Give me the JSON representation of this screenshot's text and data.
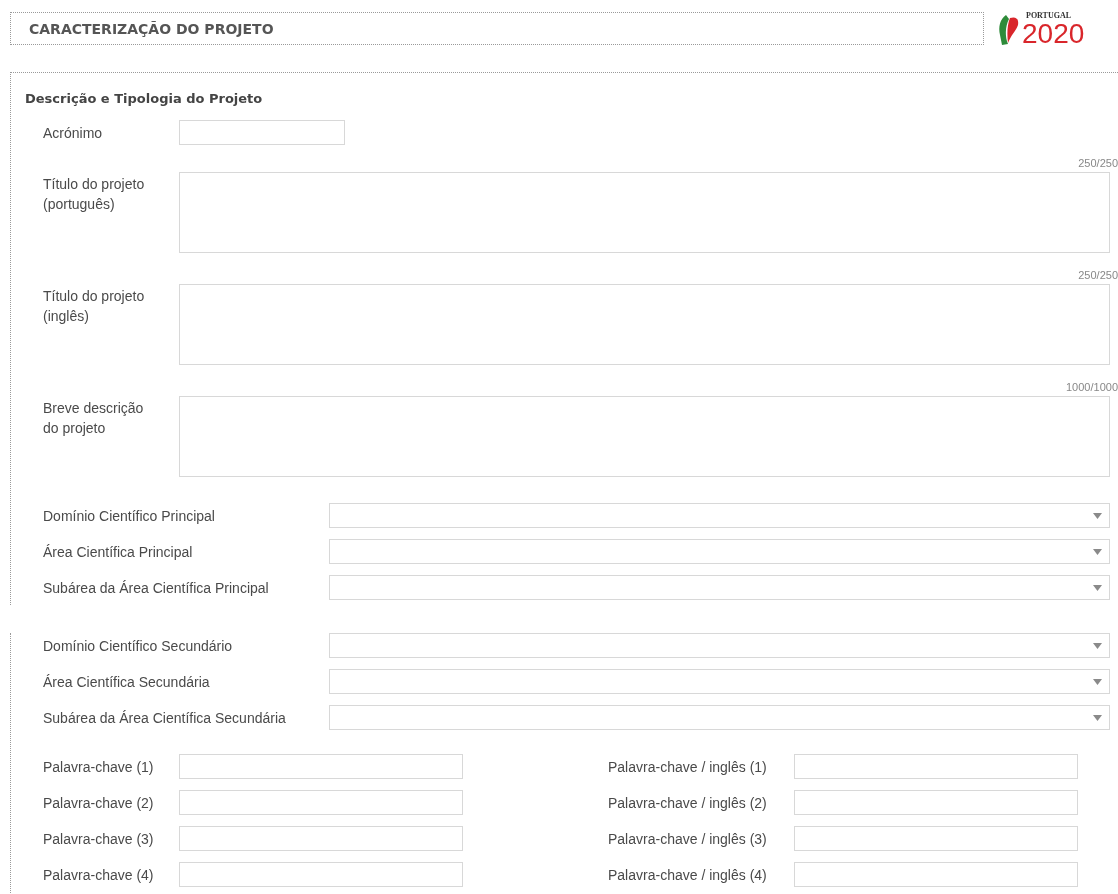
{
  "header": {
    "title": "CARACTERIZAÇÃO DO PROJETO"
  },
  "logo": {
    "caption": "PORTUGAL",
    "year": "2020"
  },
  "section": {
    "title": "Descrição e Tipologia do Projeto",
    "acronym": {
      "label": "Acrónimo"
    },
    "text_areas": [
      {
        "label": "Título do projeto\n(português)",
        "counter": "250/250"
      },
      {
        "label": "Título do projeto\n(inglês)",
        "counter": "250/250"
      },
      {
        "label": "Breve descrição\ndo projeto",
        "counter": "1000/1000"
      }
    ],
    "selects": [
      {
        "label": "Domínio Científico Principal"
      },
      {
        "label": "Área Científica Principal"
      },
      {
        "label": "Subárea da Área Científica Principal"
      }
    ]
  },
  "secondary": {
    "selects": [
      {
        "label": "Domínio Científico Secundário"
      },
      {
        "label": "Área Científica Secundária"
      },
      {
        "label": "Subárea da Área Científica Secundária"
      }
    ],
    "keywords": [
      {
        "label": "Palavra-chave (1)"
      },
      {
        "label": "Palavra-chave (2)"
      },
      {
        "label": "Palavra-chave (3)"
      },
      {
        "label": "Palavra-chave (4)"
      }
    ],
    "keywords_en": [
      {
        "label": "Palavra-chave / inglês (1)"
      },
      {
        "label": "Palavra-chave / inglês (2)"
      },
      {
        "label": "Palavra-chave / inglês (3)"
      },
      {
        "label": "Palavra-chave / inglês (4)"
      }
    ]
  }
}
